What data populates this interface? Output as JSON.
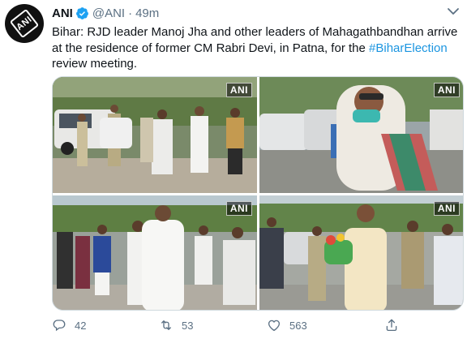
{
  "account": {
    "name": "ANI",
    "handle": "@ANI",
    "separator": "·",
    "time": "49m",
    "avatar_text": "ANI"
  },
  "tweet": {
    "text_before": "Bihar: RJD leader Manoj Jha and other leaders of Mahagathbandhan arrive at the residence of former CM Rabri Devi, in Patna, for the ",
    "hashtag": "#BiharElection",
    "text_after": " review meeting."
  },
  "media": {
    "watermark": "ANI",
    "photos": [
      "photo-1",
      "photo-2",
      "photo-3",
      "photo-4"
    ]
  },
  "actions": {
    "reply_count": "42",
    "retweet_count": "53",
    "like_count": "563"
  },
  "colors": {
    "link": "#1b95e0",
    "verified": "#1da1f2",
    "muted": "#5b7083"
  },
  "icons": [
    "verified-icon",
    "more-icon",
    "reply-icon",
    "retweet-icon",
    "like-icon",
    "share-icon"
  ]
}
